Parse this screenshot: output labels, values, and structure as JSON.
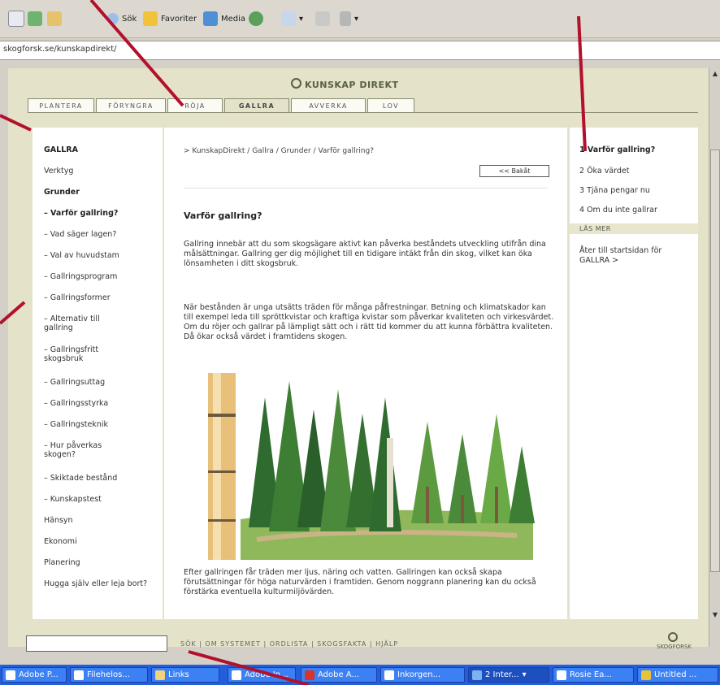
{
  "toolbar": {
    "search_label": "Sök",
    "favorites_label": "Favoriter",
    "media_label": "Media"
  },
  "address": {
    "url": "skogforsk.se/kunskapdirekt/"
  },
  "brand": {
    "title": "KUNSKAP DIREKT"
  },
  "tabs": [
    {
      "label": "PLANTERA"
    },
    {
      "label": "FÖRYNGRA"
    },
    {
      "label": "RÖJA"
    },
    {
      "label": "GALLRA"
    },
    {
      "label": "AVVERKA"
    },
    {
      "label": "LOV"
    }
  ],
  "left_nav": {
    "section": "GALLRA",
    "items": [
      {
        "label": "Verktyg"
      },
      {
        "label": "Grunder"
      },
      {
        "label": "– Varför gallring?"
      },
      {
        "label": "– Vad säger lagen?"
      },
      {
        "label": "– Val av huvudstam"
      },
      {
        "label": "– Gallringsprogram"
      },
      {
        "label": "– Gallringsformer"
      },
      {
        "label": "– Alternativ till gallring"
      },
      {
        "label": "– Gallringsfritt skogsbruk"
      },
      {
        "label": "– Gallringsuttag"
      },
      {
        "label": "– Gallringsstyrka"
      },
      {
        "label": "– Gallringsteknik"
      },
      {
        "label": "– Hur påverkas skogen?"
      },
      {
        "label": "– Skiktade bestånd"
      },
      {
        "label": "– Kunskapstest"
      },
      {
        "label": "Hänsyn"
      },
      {
        "label": "Ekonomi"
      },
      {
        "label": "Planering"
      },
      {
        "label": "Hugga själv eller leja bort?"
      }
    ]
  },
  "center": {
    "breadcrumb": "> KunskapDirekt / Gallra / Grunder / Varför gallring?",
    "back_button": "<< Bakåt",
    "article_title": "Varför gallring?",
    "para1": "Gallring innebär att du som skogsägare aktivt kan påverka beståndets utveckling utifrån dina målsättningar. Gallring ger dig möjlighet till en tidigare intäkt från din skog, vilket kan öka lönsamheten i ditt skogsbruk.",
    "para2": "När bestånden är unga utsätts träden för många påfrestningar. Betning och klimatskador kan till exempel leda till spröttkvistar och kraftiga kvistar som påverkar kvaliteten och virkesvärdet. Om du röjer och gallrar på lämpligt sätt och i rätt tid kommer du att kunna förbättra kvaliteten. Då ökar också värdet i framtidens skogen.",
    "para3": "Efter gallringen får träden mer ljus, näring och vatten. Gallringen kan också skapa förutsättningar för höga naturvärden i framtiden. Genom noggrann planering kan du också förstärka eventuella kulturmiljövärden."
  },
  "right": {
    "links": [
      {
        "label": "1 Varför gallring?"
      },
      {
        "label": "2 Öka värdet"
      },
      {
        "label": "3 Tjäna pengar nu"
      },
      {
        "label": "4 Om du inte gallrar"
      }
    ],
    "las_mer": "LÄS MER",
    "back_start": "Åter till startsidan för GALLRA >"
  },
  "footer": {
    "links": "SÖK  |  OM SYSTEMET  |  ORDLISTA  |  SKOGSFAKTA  |  HJÄLP",
    "logo": "SKOGFORSK"
  },
  "taskbar": [
    {
      "label": "Adobe P..."
    },
    {
      "label": "Filehelos..."
    },
    {
      "label": "Links"
    },
    {
      "label": "Adobe In..."
    },
    {
      "label": "Adobe A..."
    },
    {
      "label": "Inkorgen..."
    },
    {
      "label": "2 Inter..."
    },
    {
      "label": "Rosie Ea..."
    },
    {
      "label": "Untitled ..."
    }
  ],
  "colors": {
    "accent_olive": "#5a6042",
    "annotation_red": "#b3102c",
    "taskbar_blue": "#245edb"
  }
}
